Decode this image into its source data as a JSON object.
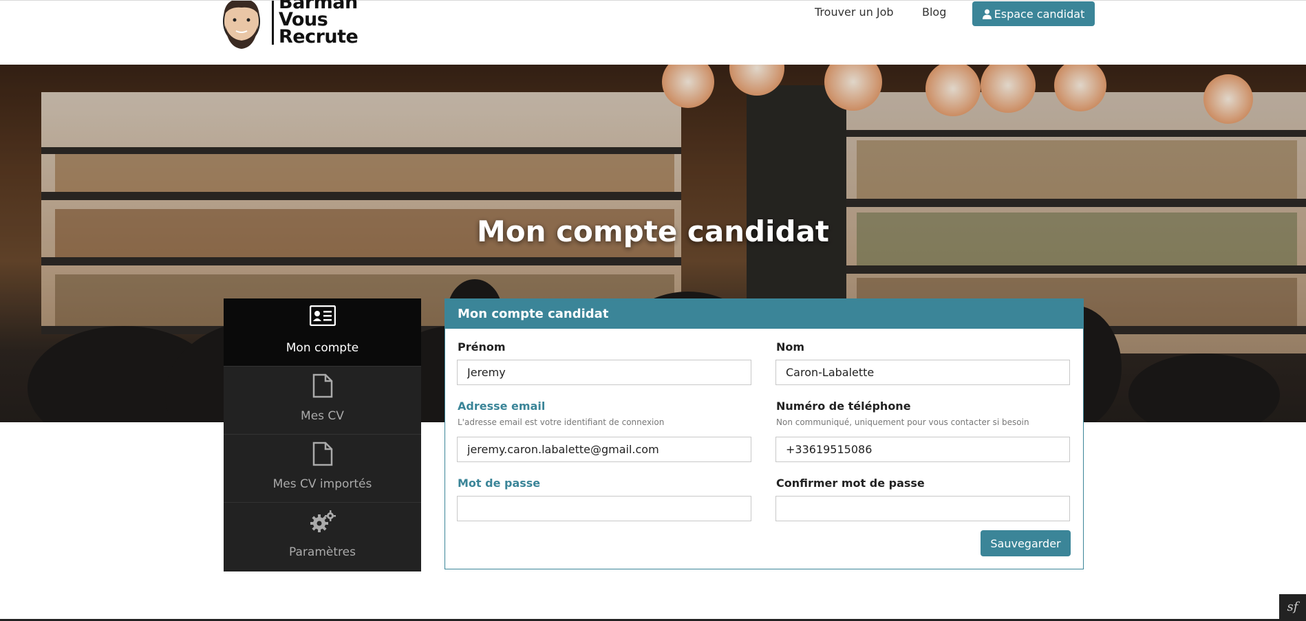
{
  "header": {
    "logo_text_line1": "Barman",
    "logo_text_line2": "Vous",
    "logo_text_line3": "Recrute",
    "nav": [
      {
        "label": "Trouver un Job"
      },
      {
        "label": "Blog"
      }
    ],
    "espace_button": {
      "label": "Espace candidat",
      "icon": "user-icon"
    }
  },
  "hero": {
    "title": "Mon compte candidat"
  },
  "sidebar": {
    "items": [
      {
        "label": "Mon compte",
        "icon": "id-card-icon",
        "active": true
      },
      {
        "label": "Mes CV",
        "icon": "file-icon",
        "active": false
      },
      {
        "label": "Mes CV importés",
        "icon": "file-icon",
        "active": false
      },
      {
        "label": "Paramètres",
        "icon": "gears-icon",
        "active": false
      }
    ]
  },
  "form": {
    "title": "Mon compte candidat",
    "prenom": {
      "label": "Prénom",
      "value": "Jeremy"
    },
    "nom": {
      "label": "Nom",
      "value": "Caron-Labalette"
    },
    "email": {
      "label": "Adresse email",
      "help": "L'adresse email est votre identifiant de connexion",
      "value": "jeremy.caron.labalette@gmail.com"
    },
    "telephone": {
      "label": "Numéro de téléphone",
      "help": "Non communiqué, uniquement pour vous contacter si besoin",
      "value": "+33619515086"
    },
    "password": {
      "label": "Mot de passe",
      "value": ""
    },
    "confirm_password": {
      "label": "Confirmer mot de passe",
      "value": ""
    },
    "save_label": "Sauvegarder"
  },
  "footer": {
    "symfony_badge": "sf"
  },
  "colors": {
    "accent": "#3b8598",
    "sidebar_bg": "#222222",
    "sidebar_active_bg": "#0a0a0a"
  }
}
